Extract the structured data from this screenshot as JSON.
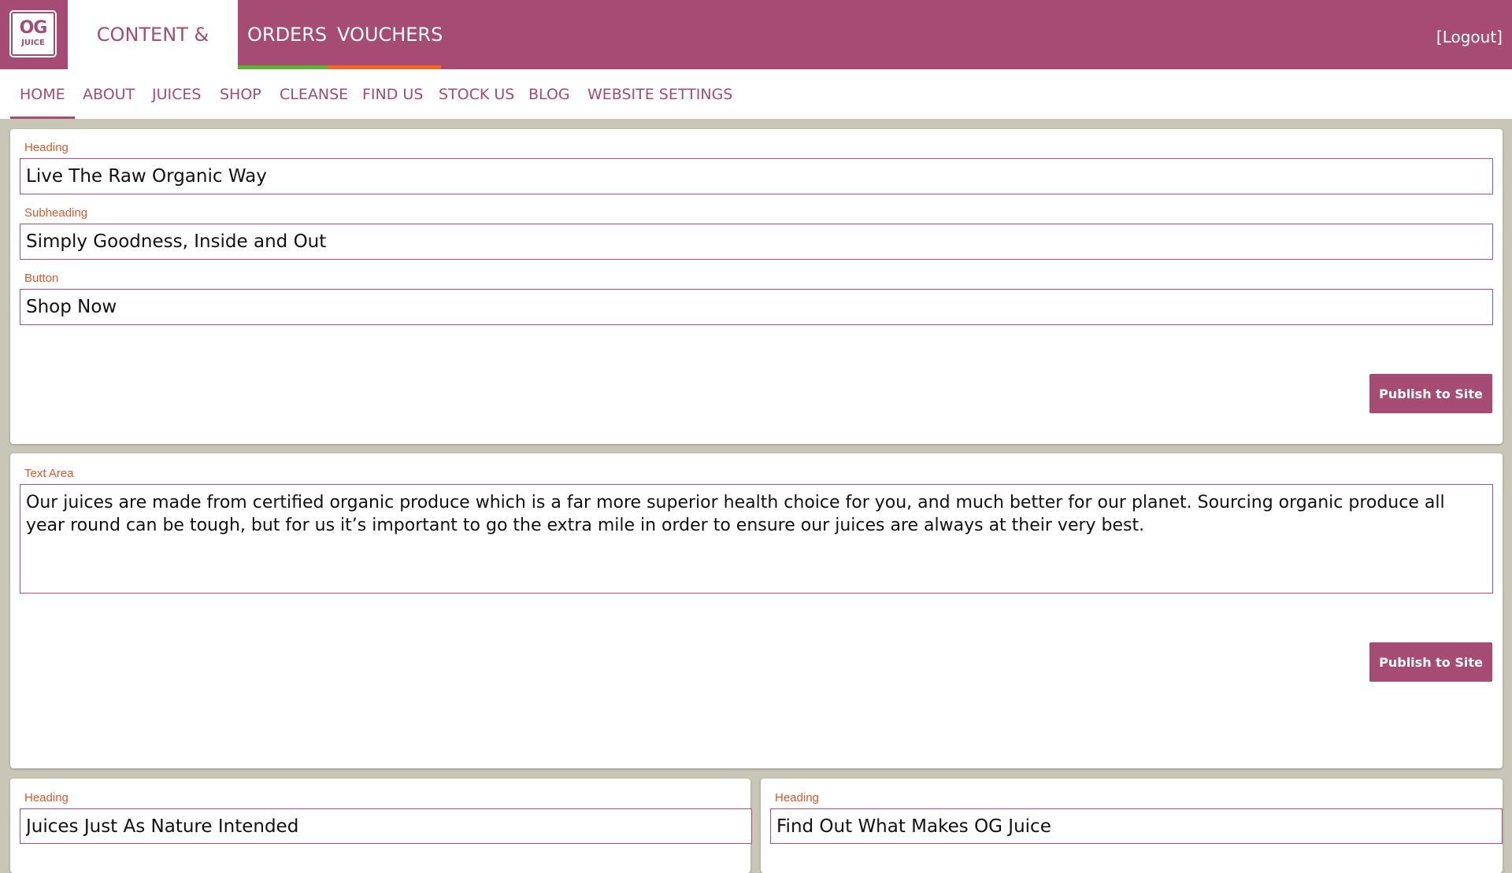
{
  "logo": {
    "line1": "OG",
    "line2": "JUICE"
  },
  "main_tabs": [
    {
      "label": "CONTENT & BLOG",
      "active": true
    },
    {
      "label": "ORDERS"
    },
    {
      "label": "VOUCHERS"
    }
  ],
  "logout_label": "[Logout]",
  "subnav": [
    {
      "label": "HOME",
      "active": true
    },
    {
      "label": "ABOUT"
    },
    {
      "label": "JUICES"
    },
    {
      "label": "SHOP"
    },
    {
      "label": "CLEANSE"
    },
    {
      "label": "FIND US"
    },
    {
      "label": "STOCK US"
    },
    {
      "label": "BLOG"
    },
    {
      "label": "WEBSITE SETTINGS"
    }
  ],
  "hero": {
    "heading_label": "Heading",
    "heading_value": "Live The Raw Organic Way",
    "subheading_label": "Subheading",
    "subheading_value": "Simply Goodness, Inside and Out",
    "button_label": "Button",
    "button_value": "Shop Now",
    "publish_label": "Publish to Site"
  },
  "intro": {
    "textarea_label": "Text Area",
    "textarea_value": "Our juices are made from certified organic produce which is a far more superior health choice for you, and much better for our planet. Sourcing organic produce all year round can be tough, but for us it’s important to go the extra mile in order to ensure our juices are always at their very best.",
    "publish_label": "Publish to Site"
  },
  "left_card": {
    "heading_label": "Heading",
    "heading_value": "Juices Just As Nature Intended"
  },
  "right_card": {
    "heading_label": "Heading",
    "heading_value": "Find Out What Makes OG Juice"
  },
  "colors": {
    "brand": "#a64b73",
    "label_orange": "#e2582a",
    "tab_green": "#5bb131",
    "tab_orange": "#f26522",
    "page_bg": "#c8c7b7"
  }
}
